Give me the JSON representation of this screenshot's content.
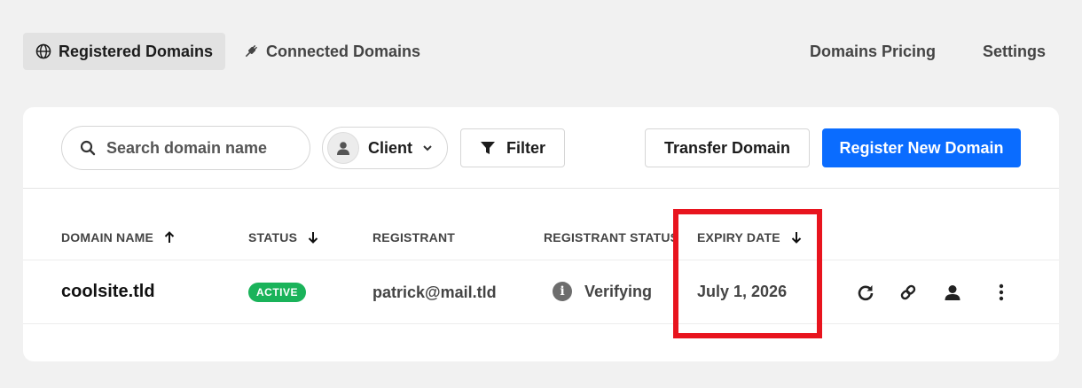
{
  "tabs": [
    {
      "label": "Registered Domains",
      "icon": "globe-icon",
      "active": true
    },
    {
      "label": "Connected Domains",
      "icon": "plug-icon",
      "active": false
    }
  ],
  "nav_links": {
    "pricing": "Domains Pricing",
    "settings": "Settings"
  },
  "toolbar": {
    "search_placeholder": "Search domain name",
    "client_label": "Client",
    "filter_label": "Filter",
    "transfer_label": "Transfer Domain",
    "register_label": "Register New Domain"
  },
  "table": {
    "headers": [
      {
        "label": "DOMAIN NAME",
        "sort": "up"
      },
      {
        "label": "STATUS",
        "sort": "down"
      },
      {
        "label": "REGISTRANT",
        "sort": null
      },
      {
        "label": "REGISTRANT STATUS",
        "sort": null
      },
      {
        "label": "EXPIRY DATE",
        "sort": "down"
      }
    ],
    "rows": [
      {
        "domain": "coolsite.tld",
        "status": "ACTIVE",
        "registrant": "patrick@mail.tld",
        "registrant_status": "Verifying",
        "expiry": "July 1, 2026",
        "actions": [
          "refresh-icon",
          "link-icon",
          "user-icon",
          "more-icon"
        ]
      }
    ]
  },
  "colors": {
    "primary": "#0a6cff",
    "active_badge": "#1ab35a",
    "highlight": "#e8141e"
  }
}
